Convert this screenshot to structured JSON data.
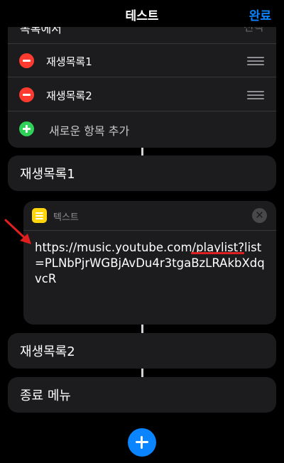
{
  "nav": {
    "title": "테스트",
    "done_label": "완료"
  },
  "list_block": {
    "peek_left": "목록에서",
    "peek_right": "선택",
    "items": [
      {
        "label": "재생목록1"
      },
      {
        "label": "재생목록2"
      }
    ],
    "add_label": "새로운 항목 추가"
  },
  "actions": {
    "playlist1": "재생목록1",
    "text_header": "텍스트",
    "text_value": "https://music.youtube.com/playlist?list=PLNbPjrWGBjAvDu4r3tgaBzLRAkbXdqvcR",
    "playlist2": "재생목록2",
    "end_menu": "종료 메뉴"
  },
  "colors": {
    "accent": "#0a84ff",
    "delete": "#ff3b30",
    "add": "#30d158",
    "notes": "#ffd60a",
    "annotation": "#e02020"
  },
  "icons": [
    "minus-circle-icon",
    "plus-circle-icon",
    "drag-handle-icon",
    "notes-icon",
    "clear-icon",
    "plus-icon",
    "arrow-annotation-icon"
  ]
}
